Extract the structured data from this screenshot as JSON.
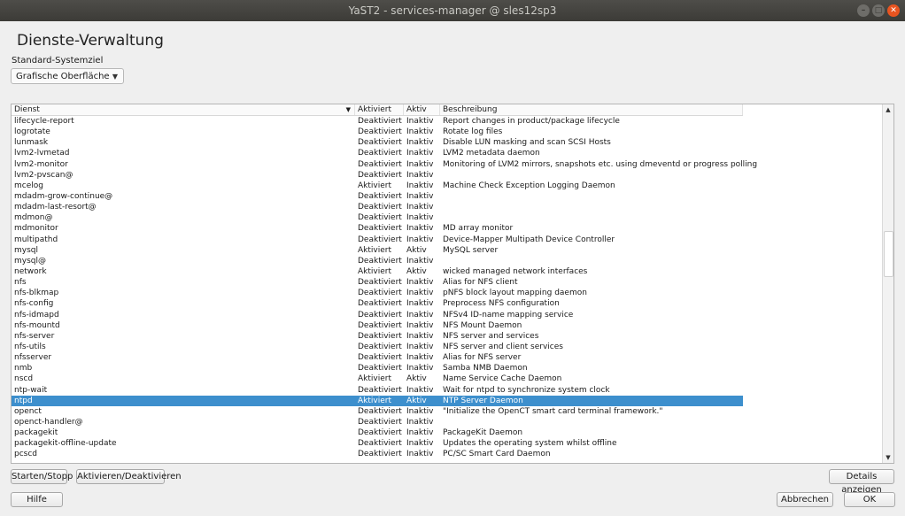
{
  "window": {
    "title": "YaST2 - services-manager @ sles12sp3"
  },
  "page_title": "Dienste-Verwaltung",
  "default_target": {
    "label": "Standard-Systemziel",
    "value": "Grafische Oberfläche"
  },
  "table": {
    "columns": [
      "Dienst",
      "Aktiviert",
      "Aktiv",
      "Beschreibung"
    ],
    "rows": [
      {
        "name": "lifecycle-report",
        "enabled": "Deaktiviert",
        "active": "Inaktiv",
        "description": "Report changes in product/package lifecycle"
      },
      {
        "name": "logrotate",
        "enabled": "Deaktiviert",
        "active": "Inaktiv",
        "description": "Rotate log files"
      },
      {
        "name": "lunmask",
        "enabled": "Deaktiviert",
        "active": "Inaktiv",
        "description": "Disable LUN masking and scan SCSI Hosts"
      },
      {
        "name": "lvm2-lvmetad",
        "enabled": "Deaktiviert",
        "active": "Inaktiv",
        "description": "LVM2 metadata daemon"
      },
      {
        "name": "lvm2-monitor",
        "enabled": "Deaktiviert",
        "active": "Inaktiv",
        "description": "Monitoring of LVM2 mirrors, snapshots etc. using dmeventd or progress polling"
      },
      {
        "name": "lvm2-pvscan@",
        "enabled": "Deaktiviert",
        "active": "Inaktiv",
        "description": ""
      },
      {
        "name": "mcelog",
        "enabled": "Aktiviert",
        "active": "Inaktiv",
        "description": "Machine Check Exception Logging Daemon"
      },
      {
        "name": "mdadm-grow-continue@",
        "enabled": "Deaktiviert",
        "active": "Inaktiv",
        "description": ""
      },
      {
        "name": "mdadm-last-resort@",
        "enabled": "Deaktiviert",
        "active": "Inaktiv",
        "description": ""
      },
      {
        "name": "mdmon@",
        "enabled": "Deaktiviert",
        "active": "Inaktiv",
        "description": ""
      },
      {
        "name": "mdmonitor",
        "enabled": "Deaktiviert",
        "active": "Inaktiv",
        "description": "MD array monitor"
      },
      {
        "name": "multipathd",
        "enabled": "Deaktiviert",
        "active": "Inaktiv",
        "description": "Device-Mapper Multipath Device Controller"
      },
      {
        "name": "mysql",
        "enabled": "Aktiviert",
        "active": "Aktiv",
        "description": "MySQL server"
      },
      {
        "name": "mysql@",
        "enabled": "Deaktiviert",
        "active": "Inaktiv",
        "description": ""
      },
      {
        "name": "network",
        "enabled": "Aktiviert",
        "active": "Aktiv",
        "description": "wicked managed network interfaces"
      },
      {
        "name": "nfs",
        "enabled": "Deaktiviert",
        "active": "Inaktiv",
        "description": "Alias for NFS client"
      },
      {
        "name": "nfs-blkmap",
        "enabled": "Deaktiviert",
        "active": "Inaktiv",
        "description": "pNFS block layout mapping daemon"
      },
      {
        "name": "nfs-config",
        "enabled": "Deaktiviert",
        "active": "Inaktiv",
        "description": "Preprocess NFS configuration"
      },
      {
        "name": "nfs-idmapd",
        "enabled": "Deaktiviert",
        "active": "Inaktiv",
        "description": "NFSv4 ID-name mapping service"
      },
      {
        "name": "nfs-mountd",
        "enabled": "Deaktiviert",
        "active": "Inaktiv",
        "description": "NFS Mount Daemon"
      },
      {
        "name": "nfs-server",
        "enabled": "Deaktiviert",
        "active": "Inaktiv",
        "description": "NFS server and services"
      },
      {
        "name": "nfs-utils",
        "enabled": "Deaktiviert",
        "active": "Inaktiv",
        "description": "NFS server and client services"
      },
      {
        "name": "nfsserver",
        "enabled": "Deaktiviert",
        "active": "Inaktiv",
        "description": "Alias for NFS server"
      },
      {
        "name": "nmb",
        "enabled": "Deaktiviert",
        "active": "Inaktiv",
        "description": "Samba NMB Daemon"
      },
      {
        "name": "nscd",
        "enabled": "Aktiviert",
        "active": "Aktiv",
        "description": "Name Service Cache Daemon"
      },
      {
        "name": "ntp-wait",
        "enabled": "Deaktiviert",
        "active": "Inaktiv",
        "description": "Wait for ntpd to synchronize system clock"
      },
      {
        "name": "ntpd",
        "enabled": "Aktiviert",
        "active": "Aktiv",
        "description": "NTP Server Daemon",
        "selected": true
      },
      {
        "name": "openct",
        "enabled": "Deaktiviert",
        "active": "Inaktiv",
        "description": "\"Initialize the OpenCT smart card terminal framework.\""
      },
      {
        "name": "openct-handler@",
        "enabled": "Deaktiviert",
        "active": "Inaktiv",
        "description": ""
      },
      {
        "name": "packagekit",
        "enabled": "Deaktiviert",
        "active": "Inaktiv",
        "description": "PackageKit Daemon"
      },
      {
        "name": "packagekit-offline-update",
        "enabled": "Deaktiviert",
        "active": "Inaktiv",
        "description": "Updates the operating system whilst offline"
      },
      {
        "name": "pcscd",
        "enabled": "Deaktiviert",
        "active": "Inaktiv",
        "description": "PC/SC Smart Card Daemon"
      }
    ]
  },
  "buttons": {
    "start_stop": "Starten/Stopp",
    "enable_disable": "Aktivieren/Deaktivieren",
    "show_details": "Details anzeigen",
    "help": "Hilfe",
    "cancel": "Abbrechen",
    "ok": "OK"
  },
  "colors": {
    "selection": "#3d8fcd",
    "titlebar": "#3c3b37",
    "close_button": "#e95420"
  }
}
